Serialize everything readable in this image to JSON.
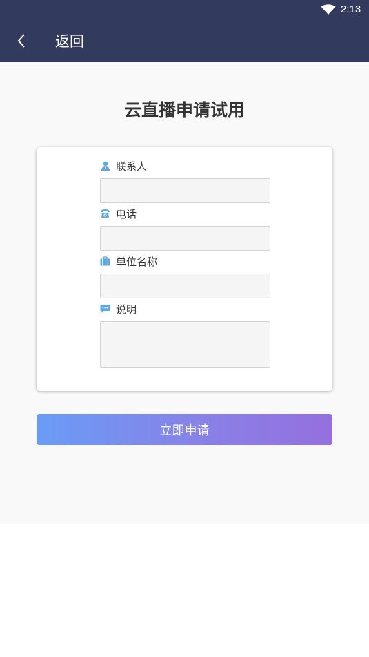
{
  "status_bar": {
    "time": "2:13",
    "wifi_icon": "wifi-icon"
  },
  "app_bar": {
    "back_icon": "chevron-left-icon",
    "back_label": "返回"
  },
  "page": {
    "title": "云直播申请试用"
  },
  "form": {
    "fields": [
      {
        "label": "联系人",
        "icon": "person-icon",
        "value": "",
        "placeholder": ""
      },
      {
        "label": "电话",
        "icon": "phone-icon",
        "value": "",
        "placeholder": ""
      },
      {
        "label": "单位名称",
        "icon": "briefcase-icon",
        "value": "",
        "placeholder": ""
      },
      {
        "label": "说明",
        "icon": "chat-bubble-icon",
        "value": "",
        "placeholder": ""
      }
    ],
    "submit_label": "立即申请"
  },
  "colors": {
    "header_bg": "#323b5e",
    "content_bg": "#f9f9f9",
    "icon_blue": "#5aa8e6",
    "button_gradient_start": "#6a9cf6",
    "button_gradient_end": "#9470de"
  }
}
